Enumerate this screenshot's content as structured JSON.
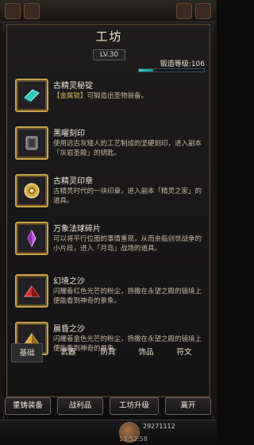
{
  "panel": {
    "title": "工坊",
    "level": "LV.30",
    "forge_label": "锻造等级:106",
    "forge_progress": 0.22
  },
  "items": [
    {
      "name": "古精灵秘锭",
      "desc_prefix": "【金属锭】",
      "desc": "可锻造出圣物装备。",
      "icon": "teal-ingot-icon",
      "icon_color": "#2ecac4"
    },
    {
      "name": "黑曜刻印",
      "desc": "使用远古灰矮人的工艺制成的坚硬刻印，进入副本「灰岩圣殿」的钥匙。",
      "icon": "obsidian-seal-icon",
      "icon_color": "#8e8e8e"
    },
    {
      "name": "古精灵印章",
      "desc": "古精灵时代的一块印章，进入副本「精灵之家」的道具。",
      "icon": "golden-seal-icon",
      "icon_color": "#d6b14a"
    },
    {
      "name": "万象法球碎片",
      "desc": "可以将平行位面的事情重现，从而亲临创世战争的小片段，进入「月岛」战场的道具。",
      "icon": "violet-shard-icon",
      "icon_color": "#c050e6"
    },
    {
      "name": "幻境之沙",
      "desc": "闪耀着红色光芒的粉尘，扬撒在永望之殿的镜境上便能看到神奇的景象。",
      "icon": "red-sand-icon",
      "icon_color": "#d12c2c"
    },
    {
      "name": "晨昏之沙",
      "desc": "闪耀着金色光芒的粉尘，扬撒在永望之殿的镜境上便能看到神奇的景象。",
      "icon": "gold-sand-icon",
      "icon_color": "#d8a035"
    }
  ],
  "tabs": [
    "基础",
    "武器",
    "防具",
    "饰品",
    "符文"
  ],
  "active_tab": "基础",
  "bottom_buttons": [
    "重铸装备",
    "战利品",
    "工坊升级",
    "离开"
  ],
  "hud": {
    "currency": "29271112",
    "time": "13:52:58"
  }
}
